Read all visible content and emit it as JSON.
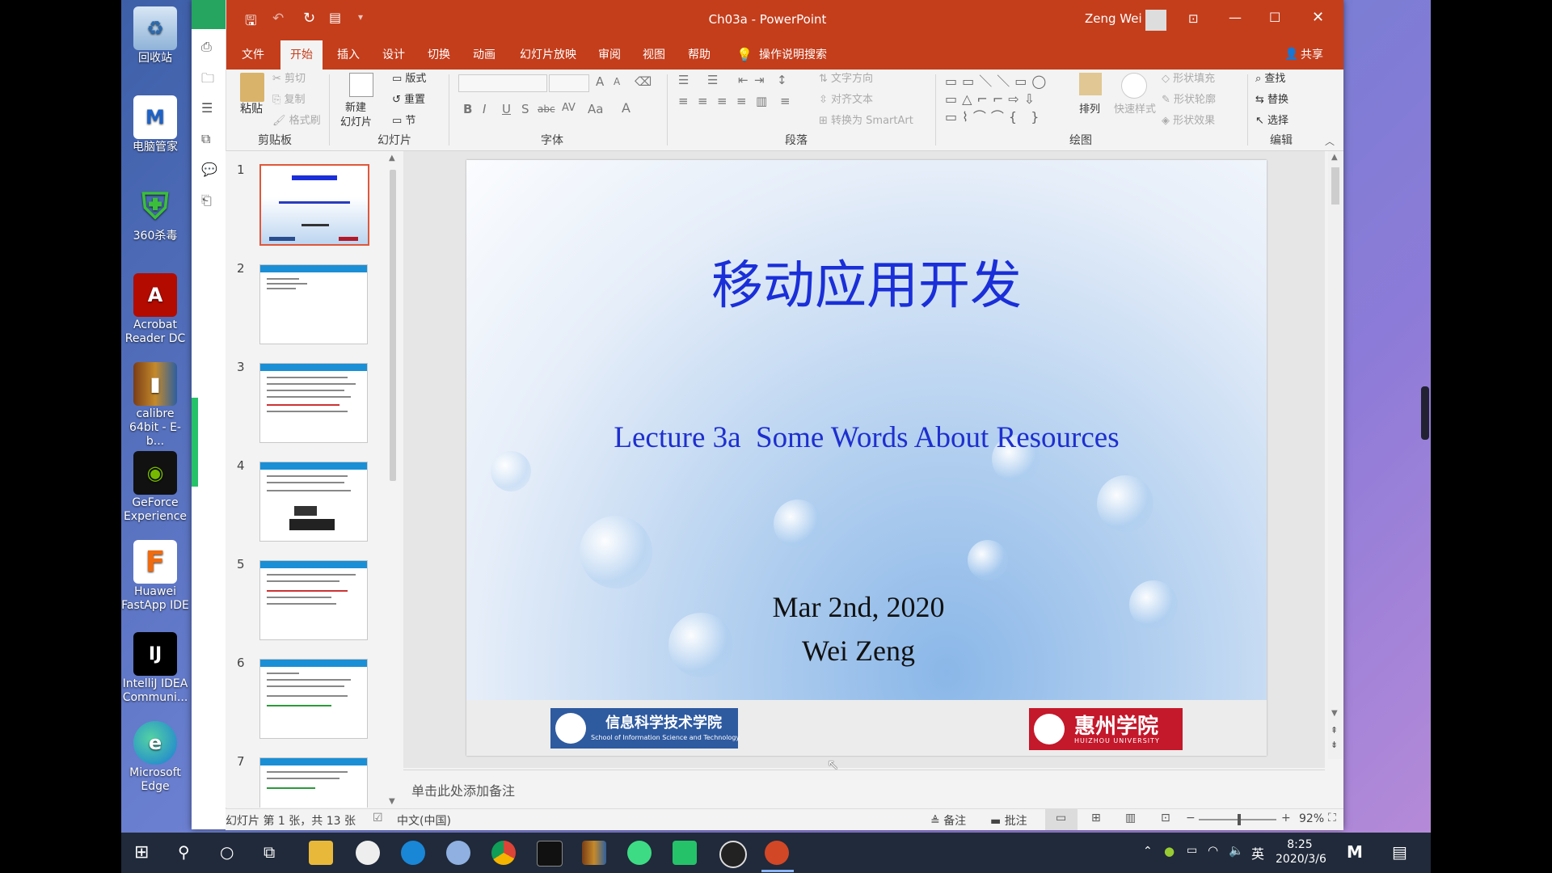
{
  "desktop": {
    "icons": [
      {
        "label": "回收站",
        "icon": "recycle-bin-icon"
      },
      {
        "label": "电脑管家",
        "icon": "pc-manager-icon"
      },
      {
        "label": "360杀毒",
        "icon": "antivirus-shield-icon"
      },
      {
        "label": "Acrobat Reader DC",
        "icon": "acrobat-icon"
      },
      {
        "label": "calibre 64bit - E-b...",
        "icon": "calibre-icon"
      },
      {
        "label": "GeForce Experience",
        "icon": "geforce-icon"
      },
      {
        "label": "Huawei FastApp IDE",
        "icon": "fastapp-icon"
      },
      {
        "label": "IntelliJ IDEA Communi...",
        "icon": "intellij-icon"
      },
      {
        "label": "Microsoft Edge",
        "icon": "edge-icon"
      }
    ]
  },
  "window": {
    "title": "Ch03a - PowerPoint",
    "user": "Zeng Wei",
    "accent": "#c43e1c"
  },
  "tabs": [
    "文件",
    "开始",
    "插入",
    "设计",
    "切换",
    "动画",
    "幻灯片放映",
    "审阅",
    "视图",
    "帮助",
    "操作说明搜索"
  ],
  "share": "共享",
  "ribbon": {
    "clipboard": {
      "label": "剪贴板",
      "paste": "粘贴",
      "cut": "剪切",
      "copy": "复制",
      "format_painter": "格式刷"
    },
    "slides": {
      "label": "幻灯片",
      "new_slide_line1": "新建",
      "new_slide_line2": "幻灯片",
      "layout": "版式",
      "reset": "重置",
      "section": "节"
    },
    "font": {
      "label": "字体",
      "bold": "B",
      "italic": "I",
      "underline": "U",
      "strike": "S",
      "shadow": "abc",
      "spacing": "AV",
      "case": "Aa",
      "color": "A",
      "grow": "A",
      "shrink": "A"
    },
    "paragraph": {
      "label": "段落",
      "text_direction": "文字方向",
      "align_text": "对齐文本",
      "smartart": "转换为 SmartArt"
    },
    "drawing": {
      "label": "绘图",
      "arrange": "排列",
      "quick_styles": "快速样式",
      "fill": "形状填充",
      "outline": "形状轮廓",
      "effects": "形状效果"
    },
    "editing": {
      "label": "编辑",
      "find": "查找",
      "replace": "替换",
      "select": "选择"
    }
  },
  "slides": [
    {
      "num": "1"
    },
    {
      "num": "2"
    },
    {
      "num": "3"
    },
    {
      "num": "4"
    },
    {
      "num": "5"
    },
    {
      "num": "6"
    },
    {
      "num": "7"
    }
  ],
  "slide": {
    "title": "移动应用开发",
    "subtitle": "Lecture 3a  Some Words About Resources",
    "date": "Mar 2nd, 2020",
    "author": "Wei Zeng",
    "logo_left_cn": "信息科学技术学院",
    "logo_left_en": "School of Information Science and Technology",
    "logo_right_cn": "惠州学院",
    "logo_right_en": "HUIZHOU UNIVERSITY",
    "title_color": "#1a2fd8"
  },
  "notes_placeholder": "单击此处添加备注",
  "status": {
    "slide_info": "幻灯片 第 1 张，共 13 张",
    "language": "中文(中国)",
    "notes": "备注",
    "comments": "批注",
    "zoom": "92%"
  },
  "taskbar": {
    "time": "8:25",
    "date": "2020/3/6",
    "ime": "英"
  }
}
